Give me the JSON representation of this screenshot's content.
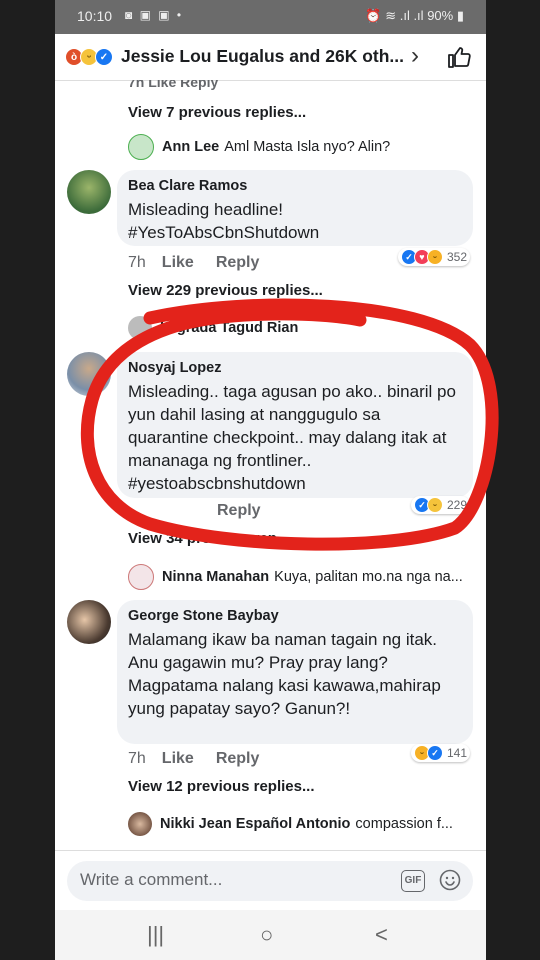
{
  "status": {
    "time": "10:10",
    "battery": "90%",
    "icons": "◙ ▣ ▣ •",
    "right_icons": "⏰ ≋ .ıl .ıl"
  },
  "header": {
    "title": "Jessie Lou Eugalus and 26K oth...",
    "chevron": "›"
  },
  "top_cut": {
    "text": "7h   Like   Reply"
  },
  "thread1": {
    "view_replies": "View 7 previous replies...",
    "reply_name": "Ann Lee",
    "reply_text": "Aml Masta Isla nyo? Alin?"
  },
  "comment1": {
    "name": "Bea Clare Ramos",
    "text": "Misleading headline!\n#YesToAbsCbnShutdown",
    "time": "7h",
    "like": "Like",
    "reply": "Reply",
    "count": "352"
  },
  "thread2": {
    "view_replies": "View 229 previous replies...",
    "reply_name": "Lagrada Tagud Rian"
  },
  "comment2": {
    "name": "Nosyaj Lopez",
    "text": "Misleading.. taga agusan po ako.. binaril po yun dahil lasing at nanggugulo sa quarantine checkpoint.. may dalang itak at mananaga ng frontliner..\n#yestoabscbnshutdown",
    "reply": "Reply",
    "count": "229"
  },
  "thread3": {
    "view_replies": "View 34 previous rep",
    "reply_name": "Ninna Manahan",
    "reply_text": "Kuya, palitan mo.na nga na..."
  },
  "comment3": {
    "name": "George Stone Baybay",
    "text": "Malamang ikaw ba naman tagain ng itak. Anu gagawin mu? Pray pray lang? Magpatama nalang kasi kawawa,mahirap yung  papatay sayo? Ganun?!",
    "time": "7h",
    "like": "Like",
    "reply": "Reply",
    "count": "141"
  },
  "thread4": {
    "view_replies": "View 12 previous replies...",
    "reply_name": "Nikki Jean Español Antonio",
    "reply_text": "compassion f..."
  },
  "composer": {
    "placeholder": "Write a comment...",
    "gif": "GIF"
  },
  "navbar": {
    "recent": "|||",
    "home": "○",
    "back": "<"
  },
  "colors": {
    "accent": "#1877f2",
    "annotation": "#e3231b"
  }
}
